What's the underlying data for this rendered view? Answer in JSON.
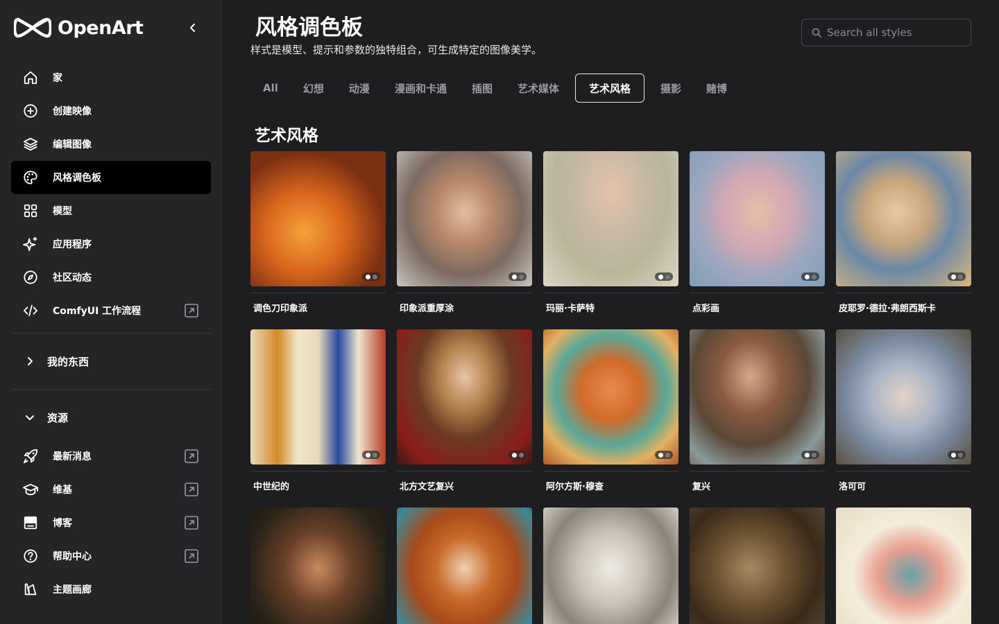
{
  "brand": {
    "name": "OpenArt"
  },
  "sidebar": {
    "items": [
      {
        "label": "家",
        "icon": "home-icon"
      },
      {
        "label": "创建映像",
        "icon": "plus-circle-icon"
      },
      {
        "label": "编辑图像",
        "icon": "layers-icon"
      },
      {
        "label": "风格调色板",
        "icon": "palette-icon",
        "active": true
      },
      {
        "label": "模型",
        "icon": "grid-icon"
      },
      {
        "label": "应用程序",
        "icon": "sparkle-icon"
      },
      {
        "label": "社区动态",
        "icon": "compass-icon"
      },
      {
        "label": "ComfyUI 工作流程",
        "icon": "code-icon",
        "external": true
      }
    ],
    "my_stuff": "我的东西",
    "resources": "资源",
    "resource_items": [
      {
        "label": "最新消息",
        "icon": "rocket-icon"
      },
      {
        "label": "维基",
        "icon": "graduation-cap-icon"
      },
      {
        "label": "博客",
        "icon": "blog-icon"
      },
      {
        "label": "帮助中心",
        "icon": "help-circle-icon"
      },
      {
        "label": "主题画廊",
        "icon": "theme-icon"
      }
    ]
  },
  "header": {
    "title": "风格调色板",
    "subtitle": "样式是模型、提示和参数的独特组合，可生成特定的图像美学。",
    "search_placeholder": "Search all styles"
  },
  "tabs": [
    "All",
    "幻想",
    "动漫",
    "漫画和卡通",
    "插图",
    "艺术媒体",
    "艺术风格",
    "摄影",
    "赌博"
  ],
  "active_tab": "艺术风格",
  "section_title": "艺术风格",
  "styles": [
    {
      "label": "调色刀印象派"
    },
    {
      "label": "印象派重厚涂"
    },
    {
      "label": "玛丽·卡萨特"
    },
    {
      "label": "点彩画"
    },
    {
      "label": "皮耶罗·德拉·弗朗西斯卡"
    },
    {
      "label": "中世纪的"
    },
    {
      "label": "北方文艺复兴"
    },
    {
      "label": "阿尔方斯·穆查"
    },
    {
      "label": "复兴"
    },
    {
      "label": "洛可可"
    },
    {
      "label": ""
    },
    {
      "label": ""
    },
    {
      "label": ""
    },
    {
      "label": ""
    },
    {
      "label": ""
    }
  ],
  "colors": {
    "bg": "#1e1e20",
    "sidebar": "#252527",
    "active": "#000000"
  }
}
